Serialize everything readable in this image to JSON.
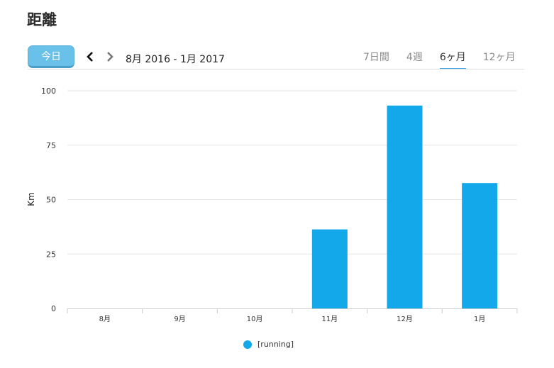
{
  "header": {
    "title": "距離"
  },
  "toolbar": {
    "today_label": "今日",
    "prev_icon": "chevron-left-icon",
    "next_icon": "chevron-right-icon",
    "date_range": "8月 2016 - 1月 2017"
  },
  "range_tabs": [
    {
      "label": "7日間",
      "active": false
    },
    {
      "label": "4週",
      "active": false
    },
    {
      "label": "6ヶ月",
      "active": true
    },
    {
      "label": "12ヶ月",
      "active": false
    }
  ],
  "colors": {
    "bar": "#12a8e9",
    "accent": "#3ba7e0",
    "today_button": "#69c1ea"
  },
  "chart_data": {
    "type": "bar",
    "ylabel": "Km",
    "xlabel": "",
    "categories": [
      "8月",
      "9月",
      "10月",
      "11月",
      "12月",
      "1月"
    ],
    "series": [
      {
        "name": "[running]",
        "values": [
          0,
          0,
          0,
          36.3,
          93.2,
          57.6
        ]
      }
    ],
    "ylim": [
      0,
      100
    ],
    "yticks": [
      0,
      25,
      50,
      75,
      100
    ],
    "grid": true,
    "legend_position": "bottom"
  }
}
